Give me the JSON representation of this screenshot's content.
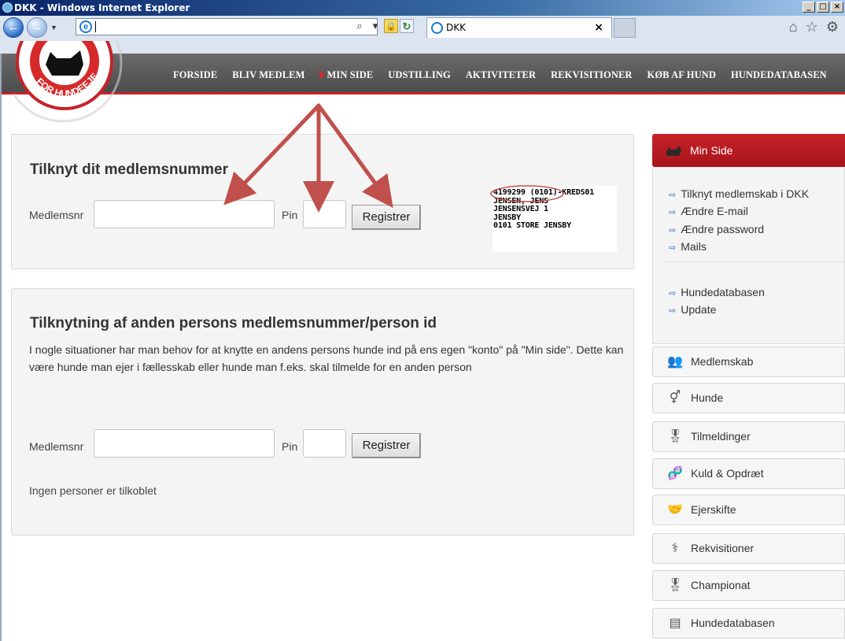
{
  "window": {
    "title": "DKK - Windows Internet Explorer"
  },
  "browser": {
    "tab_title": "DKK",
    "tab_close": "×"
  },
  "site_menu": [
    "FORSIDE",
    "BLIV MEDLEM",
    "MIN SIDE",
    "UDSTILLING",
    "AKTIVITETER",
    "REKVISITIONER",
    "KØB AF HUND",
    "HUNDEDATABASEN"
  ],
  "active_menu": "MIN SIDE",
  "logo": {
    "text": "FOR HUNDEEJERE"
  },
  "section1": {
    "title": "Tilknyt dit medlemsnummer",
    "member_label": "Medlemsnr",
    "pin_label": "Pin",
    "register_button": "Registrer",
    "example_card": [
      "4199299 (0101)-KREDS01",
      "JENSEN, JENS",
      "JENSENSVEJ 1",
      "JENSBY",
      "0101 STORE JENSBY"
    ]
  },
  "section2": {
    "title": "Tilknytning af anden persons medlemsnummer/person id",
    "description": "I nogle situationer har man behov for at knytte en andens persons hunde ind på ens egen \"konto\" på \"Min side\". Dette kan være hunde man ejer i fællesskab eller hunde man f.eks. skal tilmelde for en anden person",
    "member_label": "Medlemsnr",
    "pin_label": "Pin",
    "register_button": "Registrer",
    "status": "Ingen personer er tilkoblet"
  },
  "sidebar": {
    "header": "Min Side",
    "links": [
      "Tilknyt medlemskab i DKK",
      "Ændre E-mail",
      "Ændre password",
      "Mails"
    ],
    "links2": [
      "Hundedatabasen",
      "Update"
    ],
    "items": [
      {
        "label": "Medlemskab",
        "icon": "people-icon"
      },
      {
        "label": "Hunde",
        "icon": "gender-icon"
      },
      {
        "label": "Tilmeldinger",
        "icon": "rosette-icon"
      },
      {
        "label": "Kuld & Opdræt",
        "icon": "dna-icon"
      },
      {
        "label": "Ejerskifte",
        "icon": "handshake-icon"
      },
      {
        "label": "Rekvisitioner",
        "icon": "stethoscope-icon"
      },
      {
        "label": "Championat",
        "icon": "rosette-icon"
      },
      {
        "label": "Hundedatabasen",
        "icon": "document-icon"
      }
    ]
  },
  "colors": {
    "accent": "#c6222a",
    "nav_bg": "#555555",
    "link_arrow": "#2a6cc4",
    "annotation": "#c0504d"
  }
}
